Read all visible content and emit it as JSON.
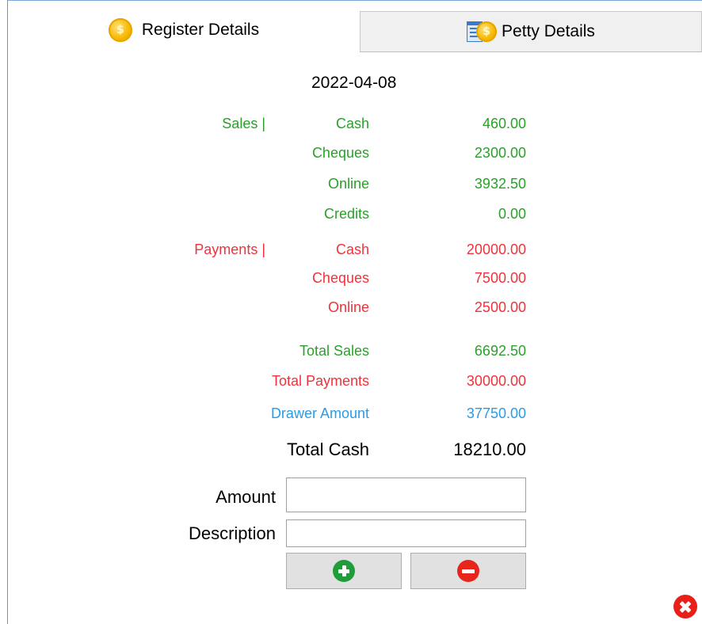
{
  "tabs": {
    "register": {
      "label": "Register Details",
      "icon": "coin-icon"
    },
    "petty": {
      "label": "Petty Details",
      "icon": "ledger-coin-icon"
    }
  },
  "date": "2022-04-08",
  "sales": {
    "section_label": "Sales |",
    "rows": [
      {
        "label": "Cash",
        "value": "460.00"
      },
      {
        "label": "Cheques",
        "value": "2300.00"
      },
      {
        "label": "Online",
        "value": "3932.50"
      },
      {
        "label": "Credits",
        "value": "0.00"
      }
    ]
  },
  "payments": {
    "section_label": "Payments |",
    "rows": [
      {
        "label": "Cash",
        "value": "20000.00"
      },
      {
        "label": "Cheques",
        "value": "7500.00"
      },
      {
        "label": "Online",
        "value": "2500.00"
      }
    ]
  },
  "totals": {
    "total_sales": {
      "label": "Total Sales",
      "value": "6692.50"
    },
    "total_payments": {
      "label": "Total Payments",
      "value": "30000.00"
    },
    "drawer_amount": {
      "label": "Drawer Amount",
      "value": "37750.00"
    },
    "total_cash": {
      "label": "Total Cash",
      "value": "18210.00"
    }
  },
  "form": {
    "amount_label": "Amount",
    "amount_value": "",
    "description_label": "Description",
    "description_value": ""
  },
  "actions": {
    "add_icon": "plus-circle-icon",
    "remove_icon": "minus-circle-icon",
    "close_icon": "close-circle-icon"
  },
  "colors": {
    "sales_green": "#2aa02a",
    "payments_red": "#f0323a",
    "drawer_blue": "#2b9be6"
  }
}
